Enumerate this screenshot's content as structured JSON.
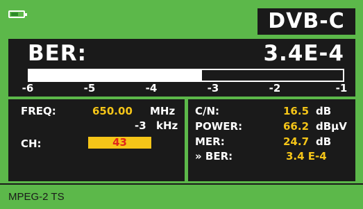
{
  "header": {
    "mode": "DVB-C",
    "battery_icon": "battery-icon",
    "battery_level": 0.6
  },
  "ber": {
    "label": "BER:",
    "value": "3.4E-4",
    "bar_fraction": 0.55,
    "scale": [
      "-6",
      "-5",
      "-4",
      "-3",
      "-2",
      "-1"
    ]
  },
  "tuning": {
    "freq_label": "FREQ:",
    "freq_value": "650.00",
    "freq_unit": "MHz",
    "offset_value": "-3",
    "offset_unit": "kHz",
    "ch_label": "CH:",
    "ch_value": "43"
  },
  "measurements": {
    "cn_label": "C/N:",
    "cn_value": "16.5",
    "cn_unit": "dB",
    "power_label": "POWER:",
    "power_value": "66.2",
    "power_unit": "dBµV",
    "mer_label": "MER:",
    "mer_value": "24.7",
    "mer_unit": "dB",
    "ber_label": "» BER:",
    "ber_value": "3.4 E-4"
  },
  "footer": {
    "stream": "MPEG-2 TS"
  },
  "colors": {
    "background": "#5cb84a",
    "panel": "#1a1a1a",
    "value": "#f5c518",
    "channel_text": "#e0261b"
  }
}
